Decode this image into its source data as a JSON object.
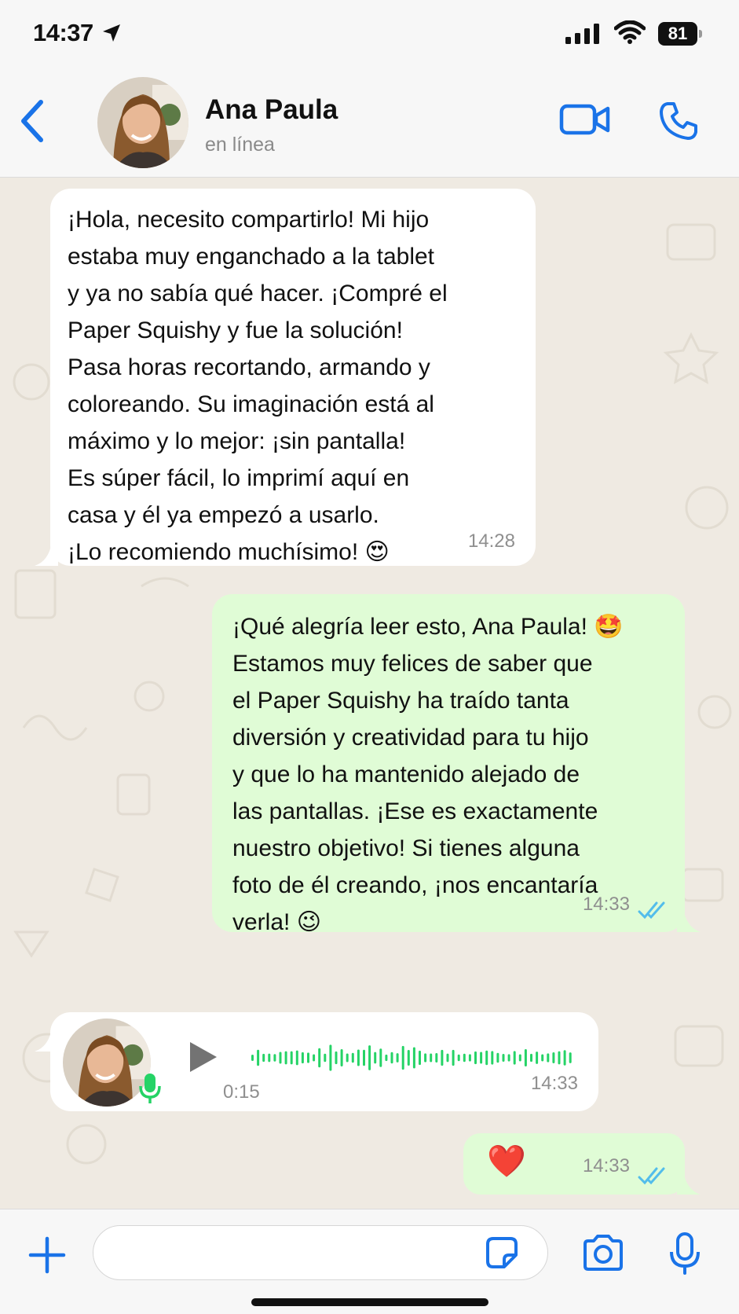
{
  "status_bar": {
    "time": "14:37",
    "battery": "81",
    "icons": [
      "location-arrow-icon",
      "cellular-signal-icon",
      "wifi-icon",
      "battery-icon"
    ]
  },
  "header": {
    "contact_name": "Ana Paula",
    "contact_status": "en línea",
    "icons": [
      "back-chevron-icon",
      "video-call-icon",
      "phone-call-icon"
    ],
    "accent_color": "#1a73e8"
  },
  "messages": [
    {
      "direction": "incoming",
      "text": "¡Hola, necesito compartirlo! Mi hijo\nestaba muy enganchado a la tablet\ny ya no sabía qué hacer. ¡Compré el\nPaper Squishy y fue la solución!\nPasa horas recortando, armando y\ncoloreando. Su imaginación está al\nmáximo y lo mejor: ¡sin pantalla!\nEs súper fácil, lo imprimí aquí en\ncasa y él ya empezó a usarlo.\n¡Lo recomiendo muchísimo! 😍",
      "time": "14:28"
    },
    {
      "direction": "outgoing",
      "text": "¡Qué alegría leer esto, Ana Paula! 🤩\nEstamos muy felices de saber que\nel Paper Squishy ha traído tanta\ndiversión y creatividad para tu hijo\ny que lo ha mantenido alejado de\nlas pantallas. ¡Ese es exactamente\nnuestro objetivo! Si tienes alguna\nfoto de él creando, ¡nos encantaría\nverla! 😉",
      "time": "14:33",
      "status": "read"
    },
    {
      "direction": "incoming",
      "type": "voice",
      "duration": "0:15",
      "time": "14:33"
    },
    {
      "direction": "outgoing",
      "text": "❤️",
      "time": "14:33",
      "status": "read"
    }
  ],
  "input_bar": {
    "placeholder": "",
    "icons": [
      "plus-icon",
      "sticker-icon",
      "camera-icon",
      "microphone-icon"
    ]
  },
  "colors": {
    "incoming_bubble": "#ffffff",
    "outgoing_bubble": "#e0fcd6",
    "chat_background": "#efeae2",
    "read_ticks": "#53bdeb",
    "waveform": "#25d366"
  }
}
